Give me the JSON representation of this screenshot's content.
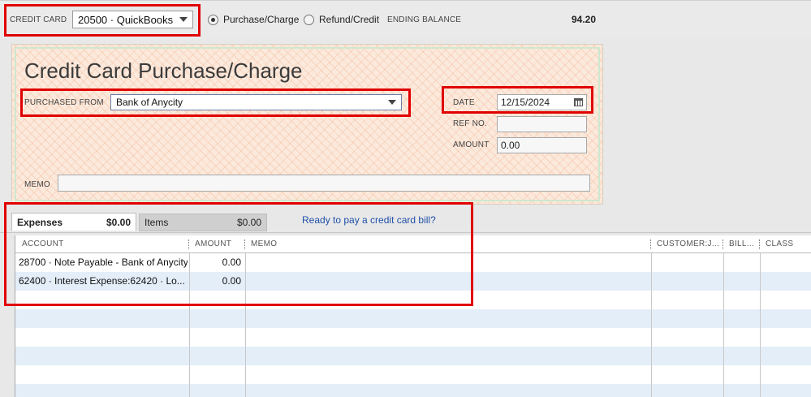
{
  "header": {
    "credit_card_label": "CREDIT CARD",
    "credit_card_value": "20500 · QuickBooks ...",
    "radio_purchase": "Purchase/Charge",
    "radio_refund": "Refund/Credit",
    "ending_balance_label": "ENDING BALANCE",
    "ending_balance_value": "94.20"
  },
  "form": {
    "title": "Credit Card Purchase/Charge",
    "purchased_from_label": "PURCHASED FROM",
    "purchased_from_value": "Bank of Anycity",
    "date_label": "DATE",
    "date_value": "12/15/2024",
    "ref_label": "REF NO.",
    "ref_value": "",
    "amount_label": "AMOUNT",
    "amount_value": "0.00",
    "memo_label": "MEMO",
    "memo_value": ""
  },
  "tabs": {
    "expenses_label": "Expenses",
    "expenses_total": "$0.00",
    "items_label": "Items",
    "items_total": "$0.00",
    "pay_bill_link": "Ready to pay a credit card bill?"
  },
  "table": {
    "columns": [
      "ACCOUNT",
      "AMOUNT",
      "MEMO",
      "CUSTOMER:J...",
      "BILL...",
      "CLASS"
    ],
    "rows": [
      {
        "account": "28700 · Note Payable - Bank of Anycity",
        "amount": "0.00"
      },
      {
        "account": "62400 · Interest Expense:62420 · Lo...",
        "amount": "0.00"
      }
    ]
  },
  "colors": {
    "highlight": "#e00000",
    "row_alt": "#e4eef9",
    "link": "#1f4fa8"
  }
}
